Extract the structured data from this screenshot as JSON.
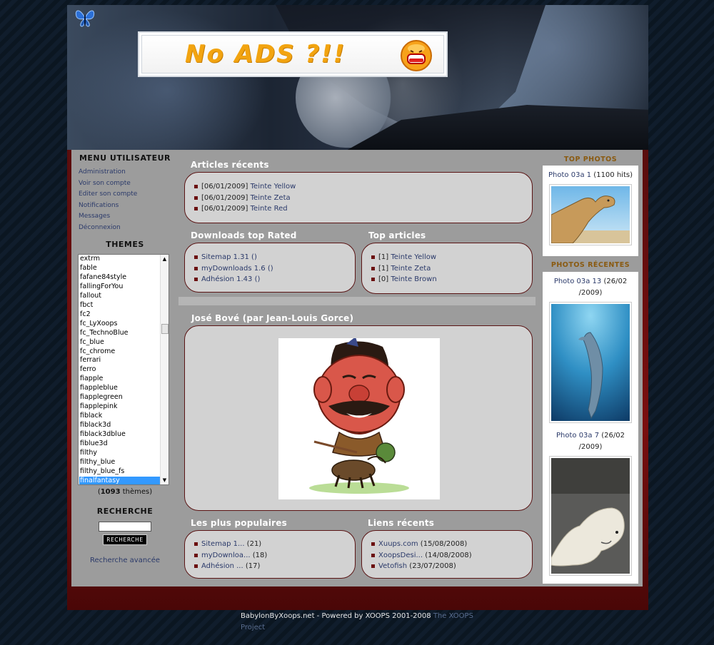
{
  "header": {
    "ad_text": "No ADS ?!!"
  },
  "user_menu": {
    "title": "MENU UTILISATEUR",
    "items": [
      "Administration",
      "Voir son compte",
      "Editer son compte",
      "Notifications",
      "Messages",
      "Déconnexion"
    ]
  },
  "themes": {
    "title": "THEMES",
    "items": [
      "extrm",
      "fable",
      "fafane84style",
      "fallingForYou",
      "fallout",
      "fbct",
      "fc2",
      "fc_LyXoops",
      "fc_TechnoBlue",
      "fc_blue",
      "fc_chrome",
      "ferrari",
      "ferro",
      "fiapple",
      "fiappleblue",
      "fiapplegreen",
      "fiapplepink",
      "fiblack",
      "fiblack3d",
      "fiblack3dblue",
      "fiblue3d",
      "filthy",
      "filthy_blue",
      "filthy_blue_fs",
      "finalfantasy"
    ],
    "selected": "finalfantasy",
    "count_prefix": "(",
    "count": "1093",
    "count_suffix": " thèmes)"
  },
  "search": {
    "title": "RECHERCHE",
    "button": "RECHERCHE",
    "advanced": "Recherche avancée"
  },
  "recent_articles": {
    "title": "Articles récents",
    "items": [
      {
        "date": "[06/01/2009]",
        "link": "Teinte Yellow"
      },
      {
        "date": "[06/01/2009]",
        "link": "Teinte Zeta"
      },
      {
        "date": "[06/01/2009]",
        "link": "Teinte Red"
      }
    ]
  },
  "downloads_top_rated": {
    "title": "Downloads top Rated",
    "items": [
      {
        "link": "Sitemap 1.31 ()"
      },
      {
        "link": "myDownloads 1.6 ()"
      },
      {
        "link": "Adhésion 1.43 ()"
      }
    ]
  },
  "top_articles": {
    "title": "Top articles",
    "items": [
      {
        "count": "[1]",
        "link": "Teinte Yellow"
      },
      {
        "count": "[1]",
        "link": "Teinte Zeta"
      },
      {
        "count": "[0]",
        "link": "Teinte Brown"
      }
    ]
  },
  "feature": {
    "title": "José Bové (par Jean-Louis Gorce)"
  },
  "most_popular": {
    "title": "Les plus populaires",
    "items": [
      {
        "link": "Sitemap 1...",
        "count": " (21)"
      },
      {
        "link": "myDownloa...",
        "count": " (18)"
      },
      {
        "link": "Adhésion ...",
        "count": " (17)"
      }
    ]
  },
  "recent_links": {
    "title": "Liens récents",
    "items": [
      {
        "link": "Xuups.com",
        "date": " (15/08/2008)"
      },
      {
        "link": "XoopsDesi...",
        "date": " (14/08/2008)"
      },
      {
        "link": "Vetofish",
        "date": " (23/07/2008)"
      }
    ]
  },
  "top_photos": {
    "title": "TOP PHOTOS",
    "items": [
      {
        "link": "Photo 03a 1",
        "extra": " (1100 hits)"
      }
    ]
  },
  "recent_photos": {
    "title": "PHOTOS RÉCENTES",
    "items": [
      {
        "link": "Photo 03a 13",
        "extra_a": " (26/02",
        "extra_b": "/2009)"
      },
      {
        "link": "Photo 03a 7",
        "extra_a": " (26/02",
        "extra_b": "/2009)"
      }
    ]
  },
  "footer": {
    "text": "BabylonByXoops.net - Powered by XOOPS 2001-2008 ",
    "link": "The XOOPS Project"
  },
  "colors": {
    "accent_red": "#6b1010",
    "link_blue": "#2b3a6a",
    "panel_gray": "#9c9c9c",
    "box_gray": "#d2d2d2",
    "photo_title_gold": "#8a5a10"
  }
}
